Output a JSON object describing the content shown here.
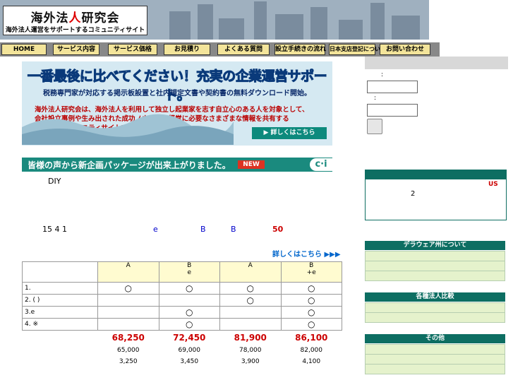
{
  "header": {
    "logo_title_pre": "海外法",
    "logo_title_red": "人",
    "logo_title_post": "研究会",
    "logo_sub": "海外法人運営をサポートするコミュニティサイト"
  },
  "nav": [
    "HOME",
    "サービス内容",
    "サービス価格",
    "お見積り",
    "よくある質問",
    "設立手続きの流れ",
    "日本支店登記について",
    "お問い合わせ"
  ],
  "banner": {
    "headline": "一番最後に比べてください！充実の企業運営サポート。",
    "sub": "税務専門家が対応する掲示板設置と社内規定文書や契約書の無料ダウンロード開始。",
    "body": [
      "海外法人研究会は、海外法人を利用して独立し起業家を志す自立心のある人を対象として、",
      "会社設立事例や生み出された成功ノウハウ、経営に必要なさまざまな情報を共有する",
      "情報交換コミュニティサイトです。"
    ],
    "button": "▶ 詳しくはこちら"
  },
  "strip": {
    "text": "皆様の声から新企画パッケージが出来上がりました。",
    "badge": "NEW",
    "icon": "c·i"
  },
  "body_text": {
    "diy": "DIY",
    "line2_a": "15 4 1",
    "line2_b": "e",
    "line2_c": "B",
    "line2_d": "B",
    "line2_e": "50",
    "more": "詳しくはこちら ▶▶▶"
  },
  "table": {
    "headers": [
      {
        "top": "A",
        "bottom": ""
      },
      {
        "top": "B",
        "bottom": "e"
      },
      {
        "top": "A",
        "bottom": ""
      },
      {
        "top": "B",
        "bottom": "+e"
      }
    ],
    "rows": [
      {
        "label": "1.",
        "marks": [
          "○",
          "○",
          "○",
          "○"
        ]
      },
      {
        "label": "2.   (      )",
        "marks": [
          "",
          "",
          "○",
          "○"
        ]
      },
      {
        "label": "3.e",
        "marks": [
          "",
          "○",
          "",
          "○"
        ]
      },
      {
        "label": "4.      ※",
        "marks": [
          "",
          "○",
          "",
          "○"
        ]
      }
    ],
    "prices": [
      "68,250",
      "72,450",
      "81,900",
      "86,100"
    ],
    "base": [
      "65,000",
      "69,000",
      "78,000",
      "82,000"
    ],
    "tax": [
      "3,250",
      "3,450",
      "3,900",
      "4,100"
    ]
  },
  "sidebar": {
    "login_label1": ":",
    "login_label2": ":",
    "news_us": "US",
    "news_num": "2",
    "sections": [
      "デラウェア州について",
      "各種法人比較",
      "その他"
    ]
  },
  "colors": {
    "nav_bg": "#f3e49a",
    "accent_green": "#0d6e62",
    "price_red": "#c00"
  }
}
